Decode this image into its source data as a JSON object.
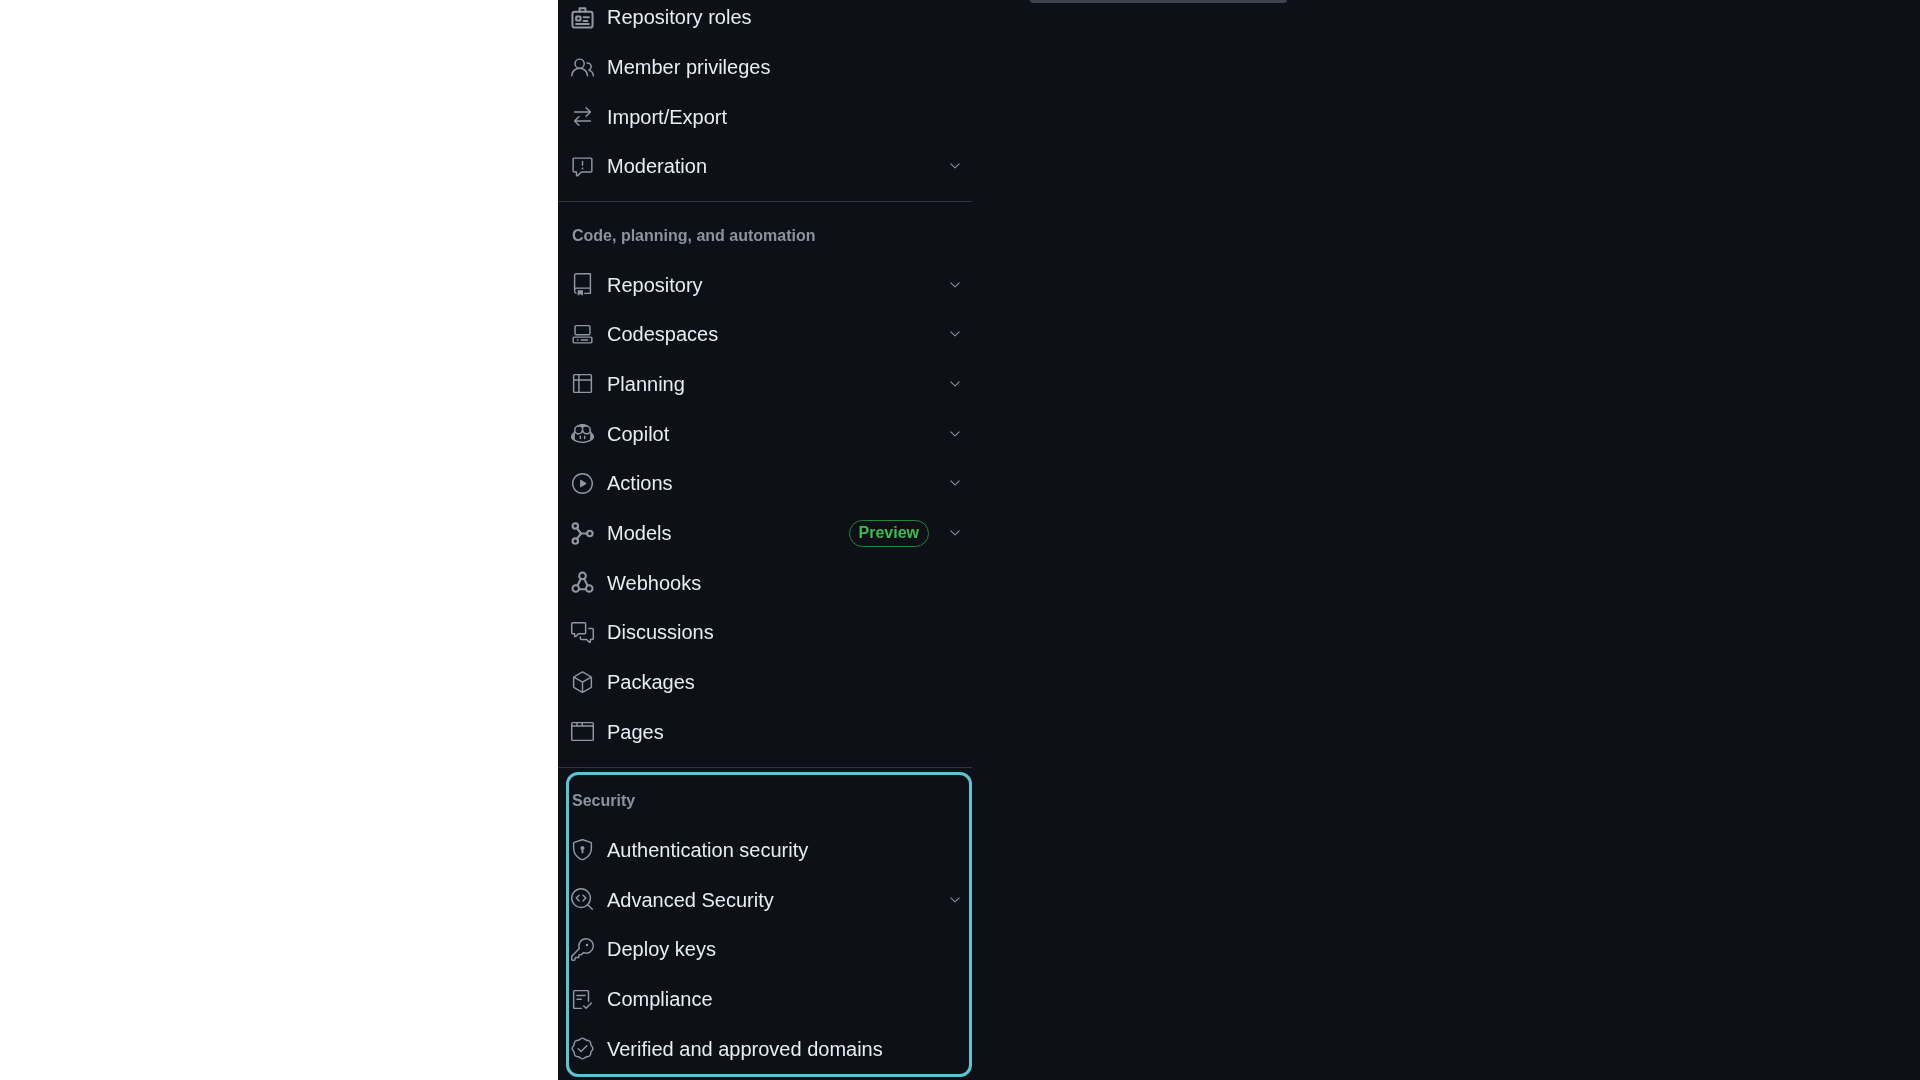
{
  "sidebar": {
    "sections": [
      {
        "items": [
          {
            "label": "Repository roles"
          },
          {
            "label": "Member privileges"
          },
          {
            "label": "Import/Export"
          },
          {
            "label": "Moderation",
            "expanded": false
          }
        ]
      },
      {
        "heading": "Code, planning, and automation",
        "items": [
          {
            "label": "Repository",
            "expanded": false
          },
          {
            "label": "Codespaces",
            "expanded": false
          },
          {
            "label": "Planning",
            "expanded": false
          },
          {
            "label": "Copilot",
            "expanded": false
          },
          {
            "label": "Actions",
            "expanded": false
          },
          {
            "label": "Models",
            "badge": "Preview",
            "expanded": false
          },
          {
            "label": "Webhooks"
          },
          {
            "label": "Discussions"
          },
          {
            "label": "Packages"
          },
          {
            "label": "Pages"
          }
        ]
      },
      {
        "heading": "Security",
        "highlighted": true,
        "items": [
          {
            "label": "Authentication security"
          },
          {
            "label": "Advanced Security",
            "expanded": false
          },
          {
            "label": "Deploy keys"
          },
          {
            "label": "Compliance"
          },
          {
            "label": "Verified and approved domains"
          }
        ]
      }
    ]
  }
}
